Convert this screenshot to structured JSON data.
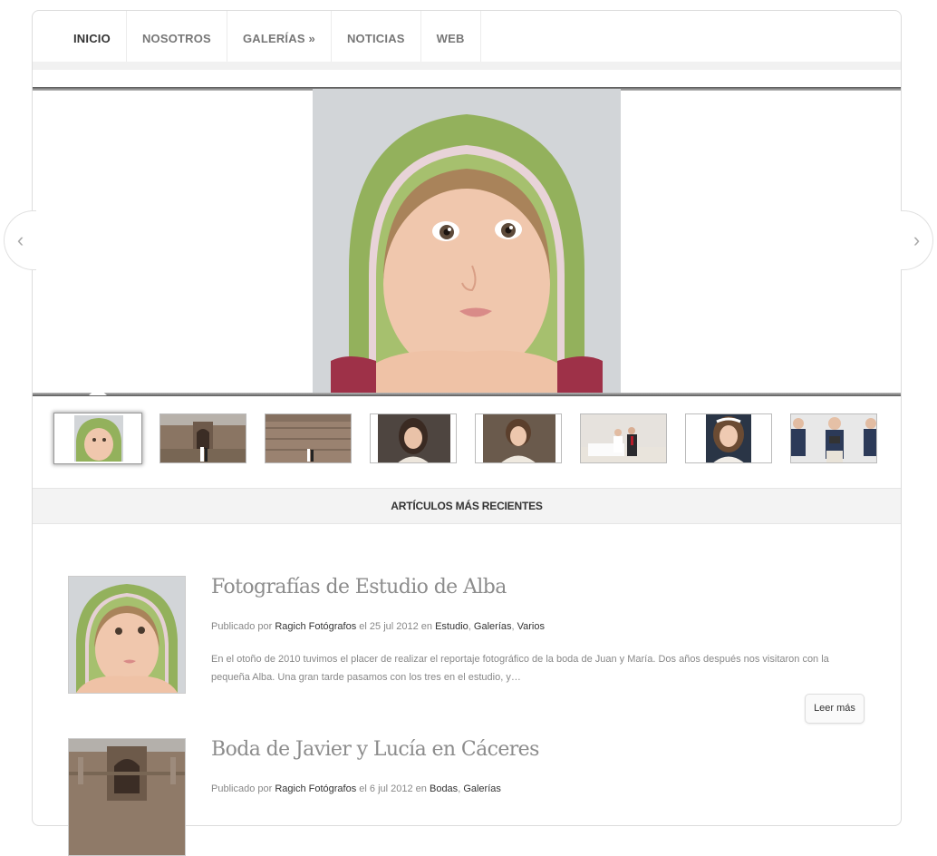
{
  "nav": {
    "items": [
      {
        "label": "INICIO",
        "active": true
      },
      {
        "label": "NOSOTROS",
        "active": false
      },
      {
        "label": "GALERÍAS »",
        "active": false
      },
      {
        "label": "NOTICIAS",
        "active": false
      },
      {
        "label": "WEB",
        "active": false
      }
    ]
  },
  "slider": {
    "prev_icon": "chevron-left-icon",
    "next_icon": "chevron-right-icon",
    "prev_glyph": "‹",
    "next_glyph": "›"
  },
  "section": {
    "title": "ARTÍCULOS MÁS RECIENTES"
  },
  "posts": [
    {
      "title": "Fotografías de Estudio de Alba",
      "meta_prefix": "Publicado por",
      "author": "Ragich Fotógrafos",
      "date_text": "el 25 jul 2012 en",
      "categories": [
        "Estudio",
        "Galerías",
        "Varios"
      ],
      "excerpt": "En el otoño de 2010 tuvimos el placer de realizar el reportaje fotográfico de la boda de Juan y María. Dos años después nos visitaron con la pequeña Alba. Una gran tarde pasamos con los tres en el estudio, y…",
      "read_more": "Leer más"
    },
    {
      "title": "Boda de Javier y Lucía en Cáceres",
      "meta_prefix": "Publicado por",
      "author": "Ragich Fotógrafos",
      "date_text": "el 6 jul 2012 en",
      "categories": [
        "Bodas",
        "Galerías"
      ]
    }
  ],
  "colors": {
    "text_dark": "#333333",
    "text_muted": "#888888",
    "title": "#8c8c8c",
    "towel_green": "#8fae5a"
  }
}
